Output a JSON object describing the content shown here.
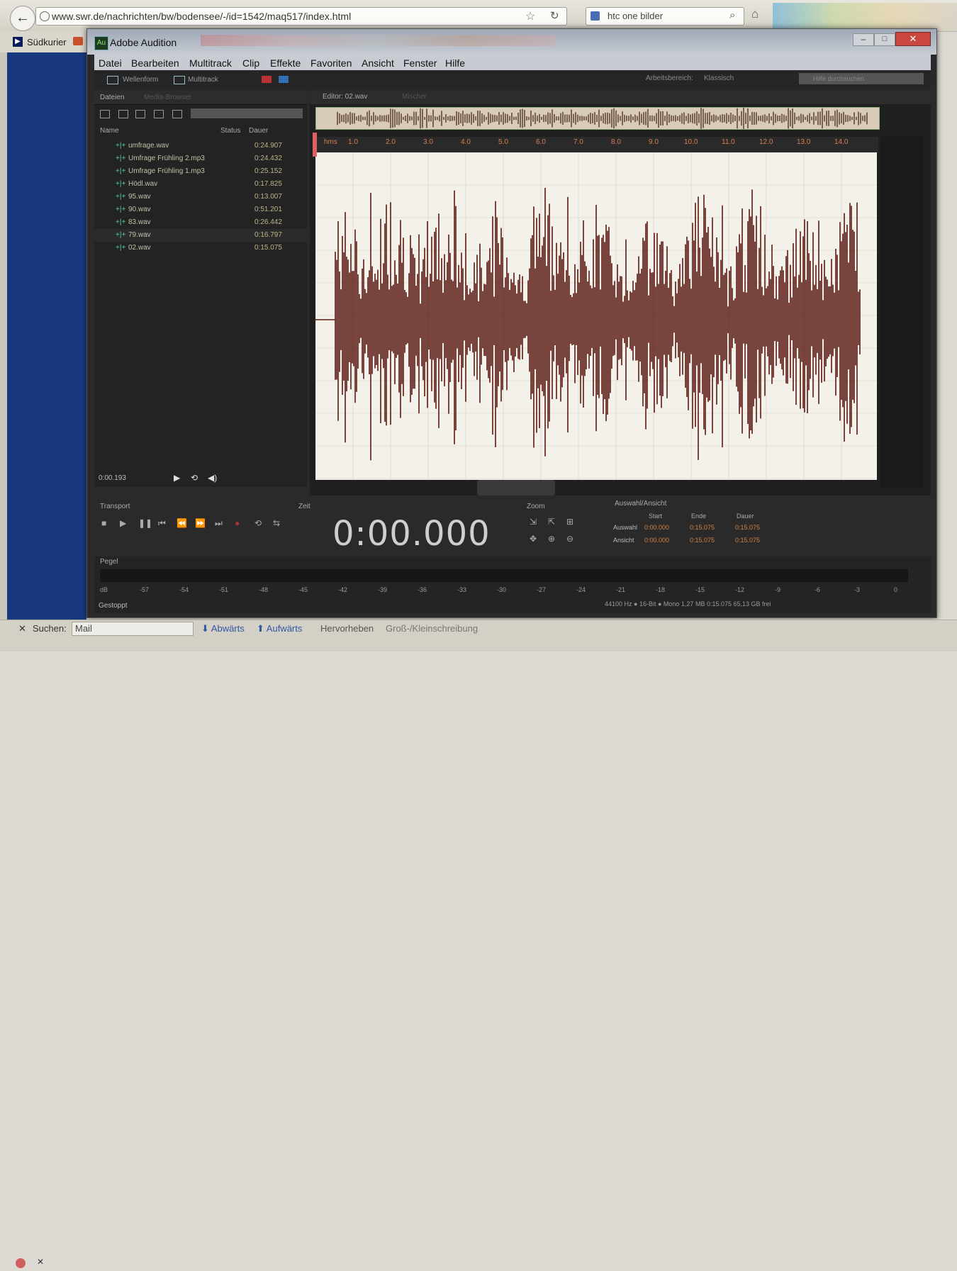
{
  "browser": {
    "back_glyph": "←",
    "url": "www.swr.de/nachrichten/bw/bodensee/-/id=1542/maq517/index.html",
    "search_value": "htc one bilder",
    "bookmark_label": "Südkurier"
  },
  "findbar": {
    "label": "Suchen:",
    "value": "Mail",
    "down": "⬇ Abwärts",
    "up": "⬆ Aufwärts",
    "highlight": "Hervorheben",
    "match_case": "Groß-/Kleinschreibung"
  },
  "audition": {
    "title": "Adobe Audition",
    "logo": "Au",
    "menu": [
      "Datei",
      "Bearbeiten",
      "Multitrack",
      "Clip",
      "Effekte",
      "Favoriten",
      "Ansicht",
      "Fenster",
      "Hilfe"
    ],
    "toolbar": {
      "waveform": "Wellenform",
      "multitrack": "Multitrack",
      "workspace_label": "Arbeitsbereich:",
      "workspace_value": "Klassisch",
      "help_search": "Hilfe durchsuchen"
    },
    "files_panel": {
      "tab": "Dateien",
      "tab2": "Media-Browser",
      "columns": {
        "name": "Name",
        "status": "Status",
        "duration": "Dauer"
      },
      "files": [
        {
          "name": "umfrage.wav",
          "duration": "0:24.907"
        },
        {
          "name": "Umfrage Frühling 2.mp3",
          "duration": "0:24.432"
        },
        {
          "name": "Umfrage Frühling 1.mp3",
          "duration": "0:25.152"
        },
        {
          "name": "Hödl.wav",
          "duration": "0:17.825"
        },
        {
          "name": "95.wav",
          "duration": "0:13.007"
        },
        {
          "name": "90.wav",
          "duration": "0:51.201"
        },
        {
          "name": "83.wav",
          "duration": "0:26.442"
        },
        {
          "name": "79.wav",
          "duration": "0:16.797"
        },
        {
          "name": "02.wav",
          "duration": "0:15.075"
        }
      ],
      "time": "0:00.193"
    },
    "editor": {
      "tab": "Editor: 02.wav",
      "mixer_tab": "Mischer",
      "ruler_unit": "hms",
      "ruler_ticks": [
        "1.0",
        "2.0",
        "3.0",
        "4.0",
        "5.0",
        "6.0",
        "7.0",
        "8.0",
        "9.0",
        "10.0",
        "11.0",
        "12.0",
        "13.0",
        "14.0"
      ]
    },
    "transport": {
      "title": "Transport"
    },
    "time": {
      "title": "Zeit",
      "value": "0:00.000"
    },
    "zoom": {
      "title": "Zoom"
    },
    "selection": {
      "title": "Auswahl/Ansicht",
      "headers": [
        "Start",
        "Ende",
        "Dauer"
      ],
      "rows": [
        {
          "label": "Auswahl",
          "values": [
            "0:00.000",
            "0:15.075",
            "0:15.075"
          ]
        },
        {
          "label": "Ansicht",
          "values": [
            "0:00.000",
            "0:15.075",
            "0:15.075"
          ]
        }
      ]
    },
    "meter": {
      "title": "Pegel",
      "scale": [
        "dB",
        "-57",
        "-54",
        "-51",
        "-48",
        "-45",
        "-42",
        "-39",
        "-36",
        "-33",
        "-30",
        "-27",
        "-24",
        "-21",
        "-18",
        "-15",
        "-12",
        "-9",
        "-6",
        "-3",
        "0"
      ],
      "status": "Gestoppt",
      "info": "44100 Hz ● 16-Bit ● Mono      1,27 MB      0:15.075      65,13 GB frei"
    }
  }
}
